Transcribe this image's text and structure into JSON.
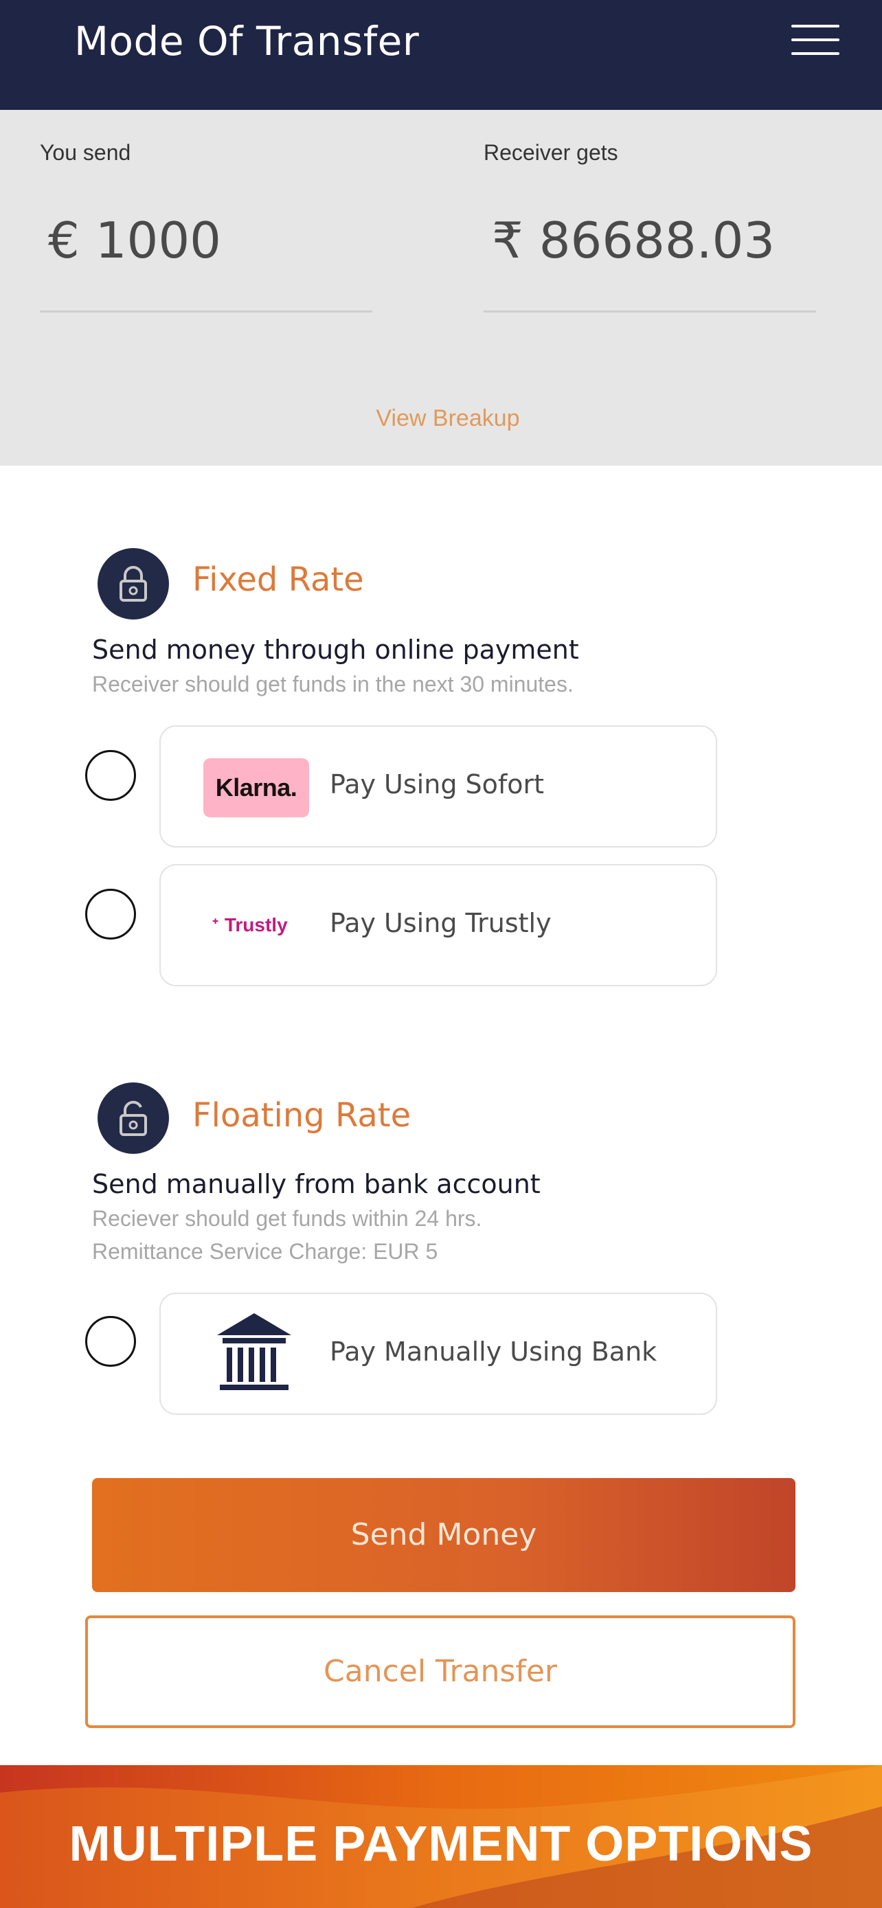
{
  "header": {
    "title": "Mode Of Transfer",
    "menu_icon": "hamburger-menu-icon"
  },
  "summary": {
    "send_label": "You send",
    "send_value": "€ 1000",
    "receive_label": "Receiver gets",
    "receive_value": "₹ 86688.03",
    "view_breakup": "View Breakup"
  },
  "fixed_rate": {
    "icon": "lock-icon",
    "title": "Fixed Rate",
    "subtitle": "Send money through online payment",
    "note": "Receiver should get funds in the next 30 minutes.",
    "options": [
      {
        "logo_text": "Klarna.",
        "label": "Pay Using Sofort"
      },
      {
        "logo_text": "Trustly",
        "label": "Pay Using Trustly"
      }
    ]
  },
  "floating_rate": {
    "icon": "unlock-icon",
    "title": "Floating Rate",
    "subtitle": "Send manually from bank account",
    "note_1": "Reciever should get funds within 24 hrs.",
    "note_2": "Remittance Service Charge: EUR 5",
    "options": [
      {
        "icon": "bank-icon",
        "label": "Pay Manually Using Bank"
      }
    ]
  },
  "actions": {
    "send": "Send Money",
    "cancel": "Cancel Transfer"
  },
  "banner": {
    "text": "MULTIPLE PAYMENT OPTIONS"
  },
  "colors": {
    "header": "#1f2544",
    "accent": "#e2701f",
    "title_orange": "#dd7a3a",
    "klarna_pink": "#ffb3c7",
    "trustly_magenta": "#c51a7e"
  }
}
